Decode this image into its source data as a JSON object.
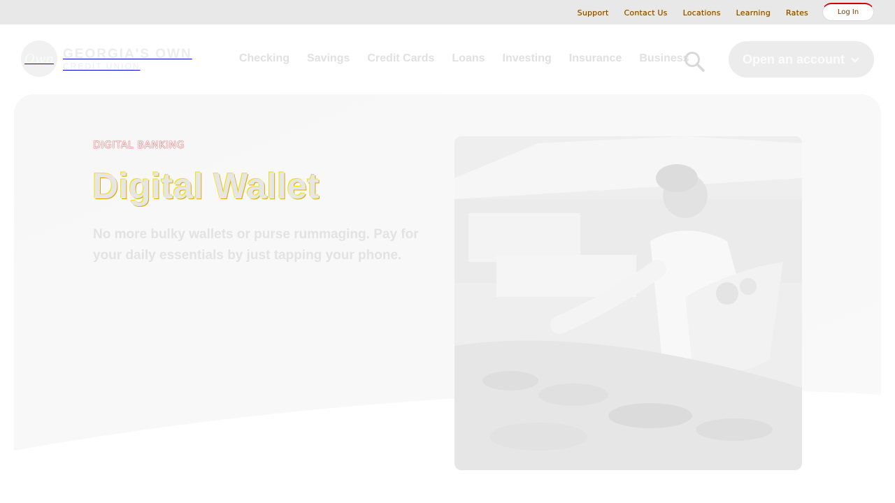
{
  "utility": {
    "links": [
      "Support",
      "Contact Us",
      "Locations",
      "Learning",
      "Rates"
    ],
    "login_label": "Log In"
  },
  "header": {
    "logo_mark": "Own",
    "logo_name": "GEORGIA'S OWN",
    "logo_sub": "CREDIT UNION",
    "nav": [
      "Checking",
      "Savings",
      "Credit Cards",
      "Loans",
      "Investing",
      "Insurance",
      "Business"
    ],
    "cta_label": "Open an account",
    "search_icon": "search-icon"
  },
  "hero": {
    "eyebrow": "DIGITAL BANKING",
    "title": "Digital Wallet",
    "description": "No more bulky wallets or purse rummaging. Pay for your daily essentials by just tapping your phone.",
    "image_alt": "woman buying produce at market"
  },
  "colors": {
    "accent_red": "#d40000",
    "accent_yellow": "#f3e200"
  }
}
